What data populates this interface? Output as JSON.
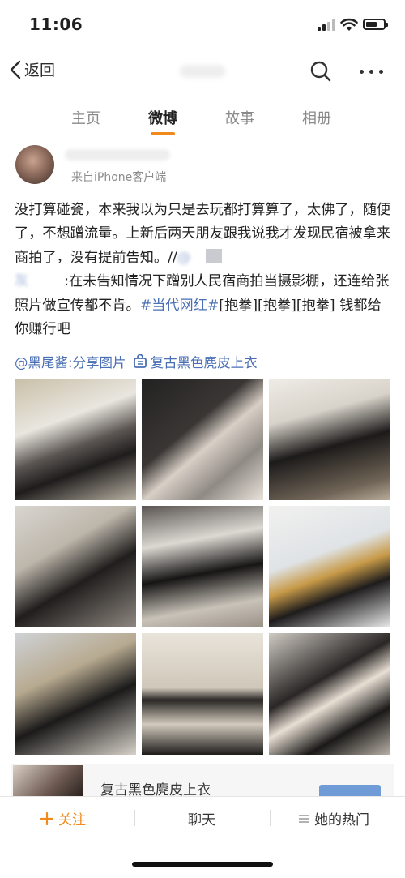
{
  "status_bar": {
    "time": "11:06"
  },
  "nav": {
    "back_label": "返回"
  },
  "tabs": [
    {
      "label": "主页",
      "active": false
    },
    {
      "label": "微博",
      "active": true
    },
    {
      "label": "故事",
      "active": false
    },
    {
      "label": "相册",
      "active": false
    }
  ],
  "post": {
    "source": "来自iPhone客户端",
    "text": {
      "part1": "没打算碰瓷，本来我以为只是去玩都打算算了，太佛了，随便了，不想蹭流量。上新后两天朋友跟我说我才发现民宿被拿来商拍了，没有提前告知。//",
      "mention_blurred": "@",
      "name_blurred": "灰",
      "mention_tail": ":在未告知情况下蹭别人民宿商拍当摄影棚，还连给张照片做宣传都不肯。",
      "topic": "#当代网红#",
      "part2": "[抱拳][抱拳][抱拳] 钱都给你赚行吧"
    },
    "repost_user": "@黑尾酱:分享图片",
    "repost_link": "复古黑色麂皮上衣"
  },
  "product": {
    "title": "复古黑色麂皮上衣"
  },
  "bottom_bar": {
    "follow": "关注",
    "chat": "聊天",
    "hot": "她的热门"
  },
  "colors": {
    "accent": "#f08a1c",
    "link": "#4a6fb5"
  }
}
